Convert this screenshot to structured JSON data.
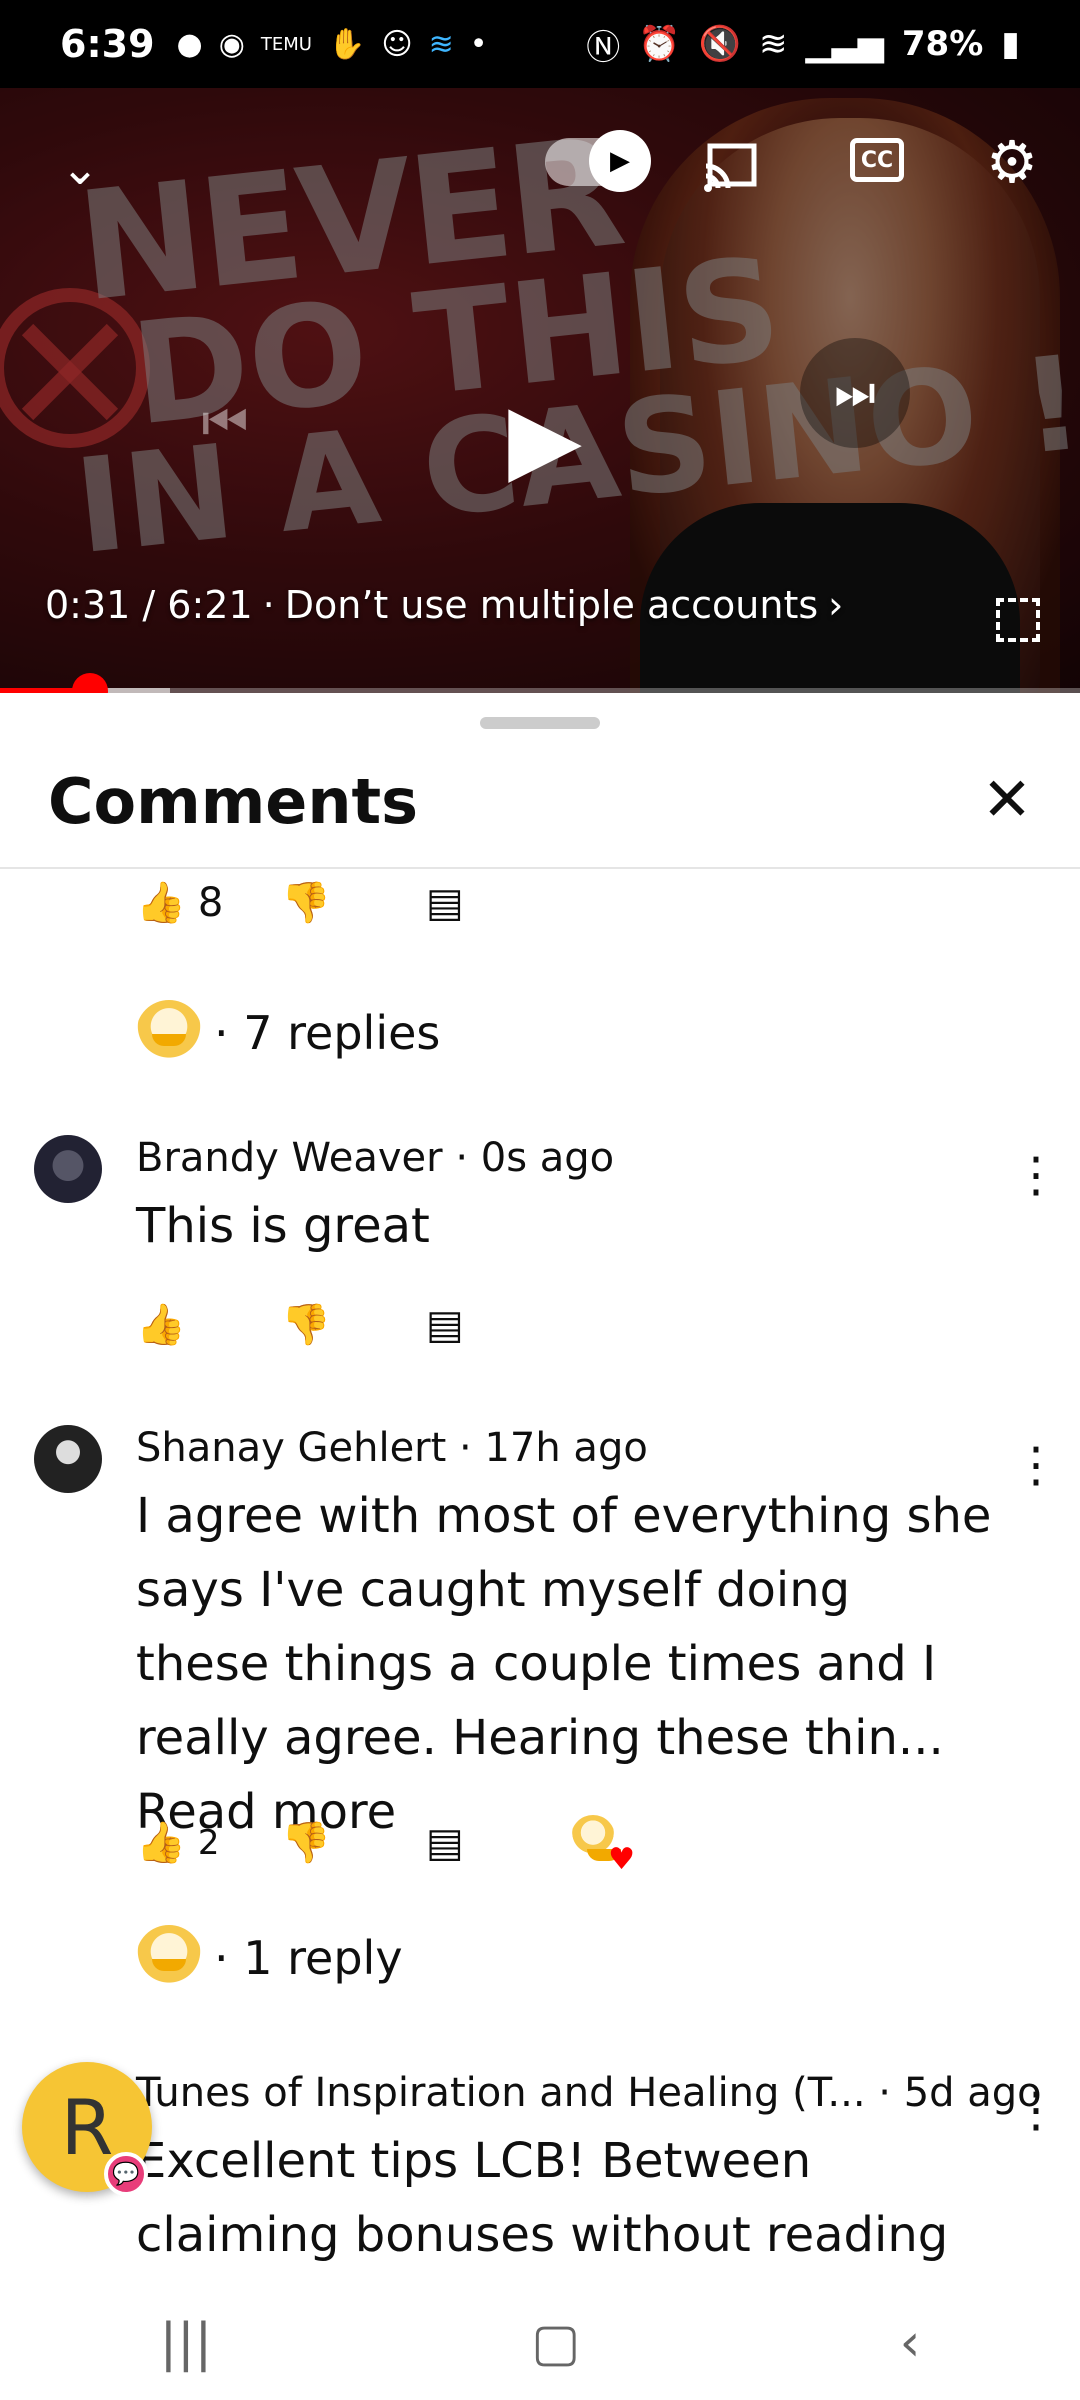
{
  "status_bar": {
    "time": "6:39",
    "left_icons": [
      "chat-bubble-icon",
      "messenger-icon",
      "temu-icon",
      "hand-icon",
      "smile-app-icon",
      "wifi-calling-icon",
      "dot-icon"
    ],
    "right_icons": [
      "nfc-icon",
      "alarm-icon",
      "mute-icon",
      "wifi-icon",
      "signal-icon"
    ],
    "battery": "78%"
  },
  "player": {
    "thumbnail_text_l1": "NEVER",
    "thumbnail_text_l2": "DO THIS",
    "thumbnail_text_l3": "IN A CASINO !",
    "current_time": "0:31",
    "duration": "6:21",
    "time_display": "0:31 / 6:21",
    "separator": "·",
    "chapter": "Don’t use multiple accounts",
    "chapter_chevron": "›",
    "progress_fraction": 0.083
  },
  "comments_panel": {
    "title": "Comments",
    "close_icon": "close-icon"
  },
  "top_actions": {
    "likes": "8"
  },
  "replies_1": {
    "label": "· 7 replies"
  },
  "comments": [
    {
      "author": "Brandy Weaver",
      "age": "· 0s ago",
      "text": "This is great",
      "likes": ""
    },
    {
      "author": "Shanay Gehlert",
      "age": "· 17h ago",
      "text": "I agree with most of everything she says I've caught myself doing these things a couple times and I really agree. Hearing these thin...",
      "read_more": "Read more",
      "likes": "2"
    },
    {
      "author": "Tunes of Inspiration and Healing (T...",
      "age": "· 5d ago",
      "text": "Excellent tips LCB! Between claiming bonuses without reading terms and"
    }
  ],
  "replies_2": {
    "label": "· 1 reply"
  },
  "fab": {
    "letter": "R"
  },
  "colors": {
    "accent_red": "#ff0000",
    "fab_yellow": "#f6c534"
  }
}
